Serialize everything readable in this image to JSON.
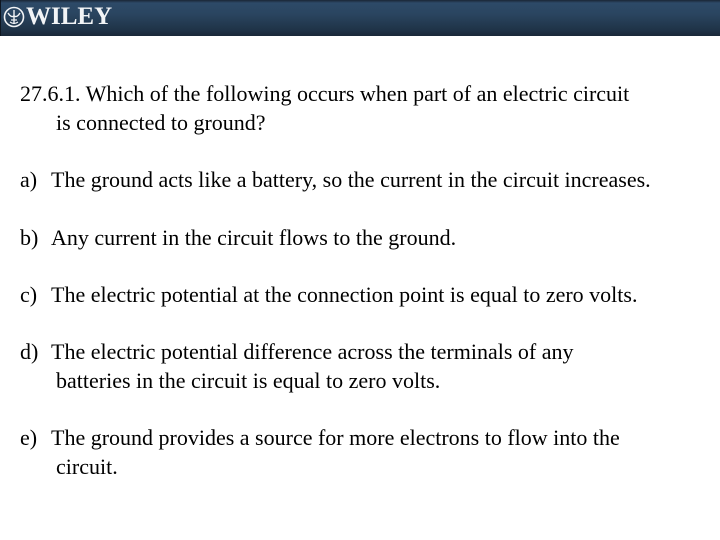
{
  "header": {
    "brand": "WILEY",
    "logo_icon": "wiley-emblem-icon",
    "background_top": "#2d4a68",
    "background_bottom": "#1a2838"
  },
  "question": {
    "number": "27.6.1.",
    "line1": "27.6.1. Which of the following occurs when part of an electric circuit",
    "line2": "is connected to ground?"
  },
  "options": [
    {
      "letter": "a)",
      "line1": "The ground acts like a battery, so the current in the circuit increases.",
      "line2": ""
    },
    {
      "letter": "b)",
      "line1": "Any current in the circuit flows to the ground.",
      "line2": ""
    },
    {
      "letter": "c)",
      "line1": "The electric potential at the connection point is equal to zero volts.",
      "line2": ""
    },
    {
      "letter": "d)",
      "line1": "The electric potential difference across the terminals of any",
      "line2": "batteries in the circuit is equal to zero volts."
    },
    {
      "letter": "e)",
      "line1": "The ground provides a source for more electrons to flow into the",
      "line2": "circuit."
    }
  ]
}
